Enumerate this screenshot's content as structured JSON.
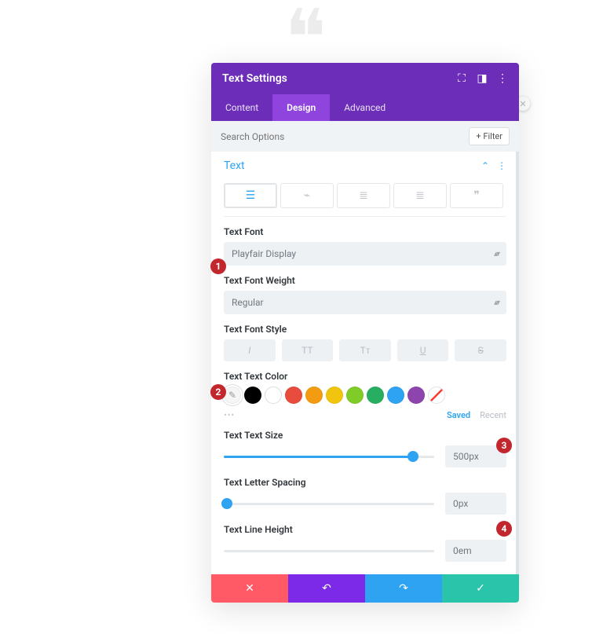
{
  "header": {
    "title": "Text Settings"
  },
  "tabs": [
    "Content",
    "Design",
    "Advanced"
  ],
  "active_tab": 1,
  "search": {
    "placeholder": "Search Options",
    "filter_label": "Filter"
  },
  "section": {
    "title": "Text"
  },
  "fields": {
    "font": {
      "label": "Text Font",
      "value": "Playfair Display"
    },
    "weight": {
      "label": "Text Font Weight",
      "value": "Regular"
    },
    "style": {
      "label": "Text Font Style"
    },
    "color": {
      "label": "Text Text Color",
      "saved": "Saved",
      "recent": "Recent"
    },
    "size": {
      "label": "Text Text Size",
      "value": "500px",
      "pct": 90
    },
    "spacing": {
      "label": "Text Letter Spacing",
      "value": "0px",
      "pct": 0
    },
    "lineheight": {
      "label": "Text Line Height",
      "value": "0em",
      "pct": 0
    }
  },
  "swatches": [
    "#ffffff",
    "#000000",
    "#ffffff",
    "#e74c3c",
    "#f39c12",
    "#f1c40f",
    "#7fcc28",
    "#27ae60",
    "#2ea3f2",
    "#8e44ad"
  ],
  "callouts": {
    "1": "1",
    "2": "2",
    "3": "3",
    "4": "4"
  }
}
